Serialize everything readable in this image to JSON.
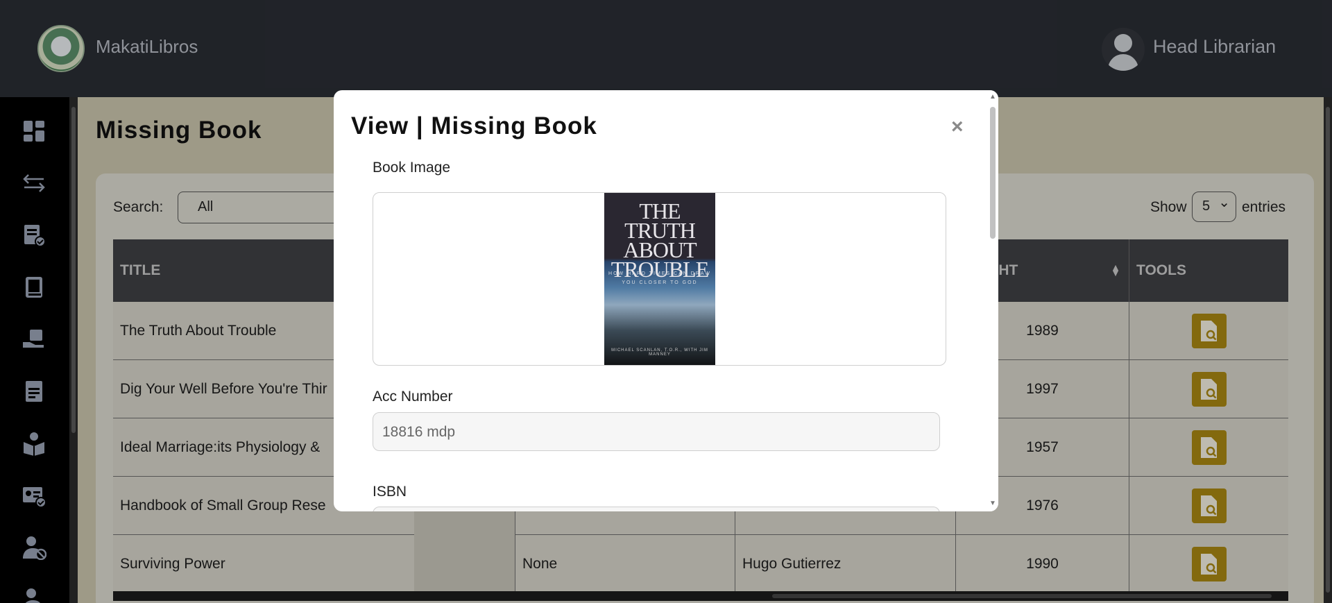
{
  "app": {
    "brand": "MakatiLibros",
    "user_role": "Head Librarian"
  },
  "page": {
    "title": "Missing Book"
  },
  "controls": {
    "search_label": "Search:",
    "search_value": "All",
    "show_label": "Show",
    "show_value": "5",
    "entries_label": "entries"
  },
  "table": {
    "headers": {
      "title": "TITLE",
      "copyright": "YRIGHT",
      "tools": "TOOLS"
    },
    "rows": [
      {
        "title": "The Truth About Trouble",
        "col3": "",
        "col4": "",
        "year": "1989"
      },
      {
        "title": "Dig Your Well Before You're Thir",
        "col3": "",
        "col4": "",
        "year": "1997"
      },
      {
        "title": "Ideal Marriage:its Physiology &",
        "col3": "",
        "col4": "",
        "year": "1957"
      },
      {
        "title": "Handbook of Small Group Rese",
        "col3": "",
        "col4": "",
        "year": "1976"
      },
      {
        "title": "Surviving Power",
        "col3": "None",
        "col4": "Hugo Gutierrez",
        "year": "1990"
      }
    ]
  },
  "modal": {
    "title": "View | Missing Book",
    "close": "×",
    "book_image_label": "Book Image",
    "cover": {
      "title_line1": "THE TRUTH",
      "title_line2": "ABOUT",
      "title_line3": "TROUBLE",
      "subtitle_line1": "HOW HARD TIMES CAN DRAW",
      "subtitle_line2": "YOU CLOSER TO GOD",
      "author": "MICHAEL SCANLAN, T.O.R., WITH JIM MANNEY"
    },
    "acc_label": "Acc Number",
    "acc_value": "18816 mdp",
    "isbn_label": "ISBN"
  },
  "colors": {
    "accent": "#a88712",
    "topbar": "#2a2d34",
    "table_header": "#3f4045"
  }
}
